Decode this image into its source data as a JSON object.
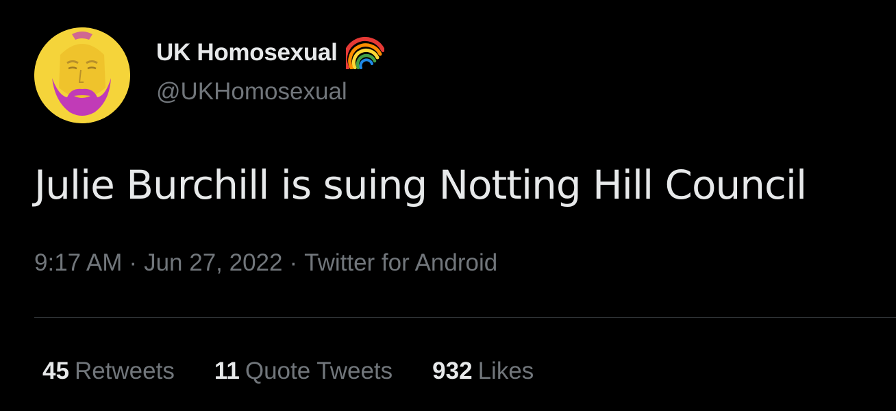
{
  "author": {
    "display_name": "UK Homosexual",
    "handle": "@UKHomosexual",
    "name_emoji_icon": "rainbow-icon",
    "avatar_colors": {
      "background": "#f5d43a",
      "beard": "#c13bb7",
      "skin": "#f0c12e"
    }
  },
  "tweet": {
    "text": "Julie Burchill is suing Notting Hill Council",
    "time": "9:17 AM",
    "separator": "·",
    "date": "Jun 27, 2022",
    "source": "Twitter for Android"
  },
  "stats": {
    "retweets": {
      "count": "45",
      "label": "Retweets"
    },
    "quotes": {
      "count": "11",
      "label": "Quote Tweets"
    },
    "likes": {
      "count": "932",
      "label": "Likes"
    }
  },
  "colors": {
    "background": "#000000",
    "primary_text": "#e7e9ea",
    "secondary_text": "#71767b",
    "divider": "#2f3336"
  }
}
